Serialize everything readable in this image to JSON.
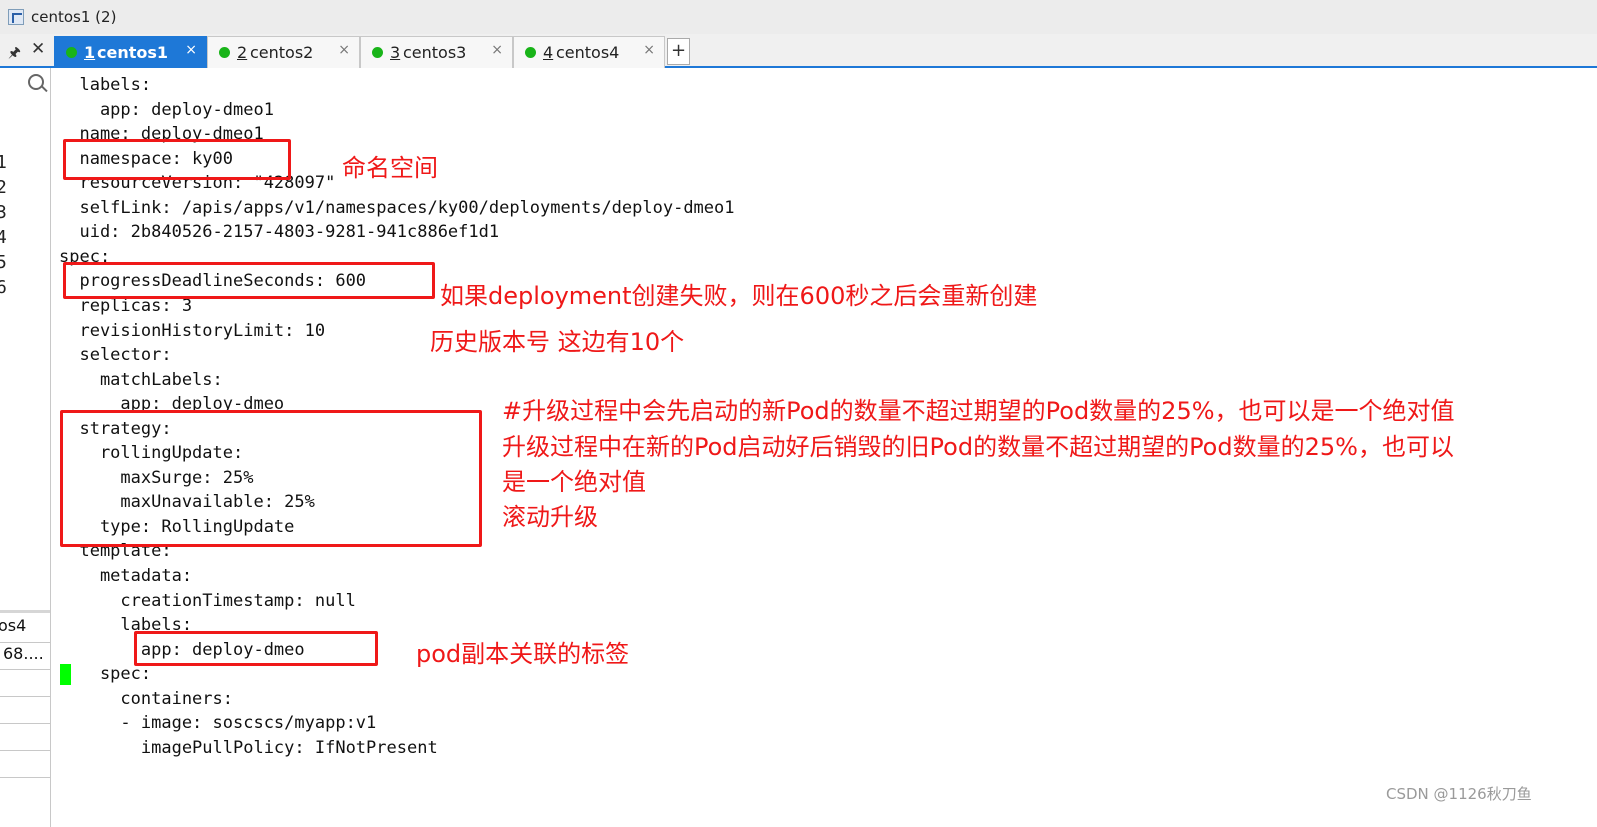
{
  "window": {
    "title": "centos1 (2)"
  },
  "tabs": [
    {
      "num": "1",
      "name": "centos1",
      "close": "×"
    },
    {
      "num": "2",
      "name": "centos2",
      "close": "×"
    },
    {
      "num": "3",
      "name": "centos3",
      "close": "×"
    },
    {
      "num": "4",
      "name": "centos4",
      "close": "×"
    }
  ],
  "tab_add_label": "+",
  "panel": {
    "pin": "🖈",
    "close": "✕"
  },
  "sidebar": {
    "numbers": [
      "1",
      "2",
      "3",
      "4",
      "5",
      "6"
    ],
    "items": [
      "os4",
      "68...."
    ]
  },
  "terminal": {
    "lines": [
      "  labels:",
      "    app: deploy-dmeo1",
      "  name: deploy-dmeo1",
      "  namespace: ky00",
      "  resourceVersion: \"428097\"",
      "  selfLink: /apis/apps/v1/namespaces/ky00/deployments/deploy-dmeo1",
      "  uid: 2b840526-2157-4803-9281-941c886ef1d1",
      "spec:",
      "  progressDeadlineSeconds: 600",
      "  replicas: 3",
      "  revisionHistoryLimit: 10",
      "  selector:",
      "    matchLabels:",
      "      app: deploy-dmeo",
      "  strategy:",
      "    rollingUpdate:",
      "      maxSurge: 25%",
      "      maxUnavailable: 25%",
      "    type: RollingUpdate",
      "  template:",
      "    metadata:",
      "      creationTimestamp: null",
      "      labels:",
      "        app: deploy-dmeo",
      "    spec:",
      "      containers:",
      "      - image: soscscs/myapp:v1",
      "        imagePullPolicy: IfNotPresent"
    ]
  },
  "annotations": {
    "namespace": "命名空间",
    "deadline": "如果deployment创建失败，则在600秒之后会重新创建",
    "history": "历史版本号 这边有10个",
    "surge": "#升级过程中会先启动的新Pod的数量不超过期望的Pod数量的25%，也可以是一个绝对值",
    "unavailable_1": "升级过程中在新的Pod启动好后销毁的旧Pod的数量不超过期望的Pod数量的25%，也可以",
    "unavailable_2": "是一个绝对值",
    "rolling": "滚动升级",
    "pod_label": "pod副本关联的标签"
  },
  "watermark": "CSDN @1126秋刀鱼",
  "colors": {
    "accent": "#1e78d7",
    "annotation": "#ef1818",
    "status_dot": "#19b419",
    "cursor": "#00ff00"
  }
}
